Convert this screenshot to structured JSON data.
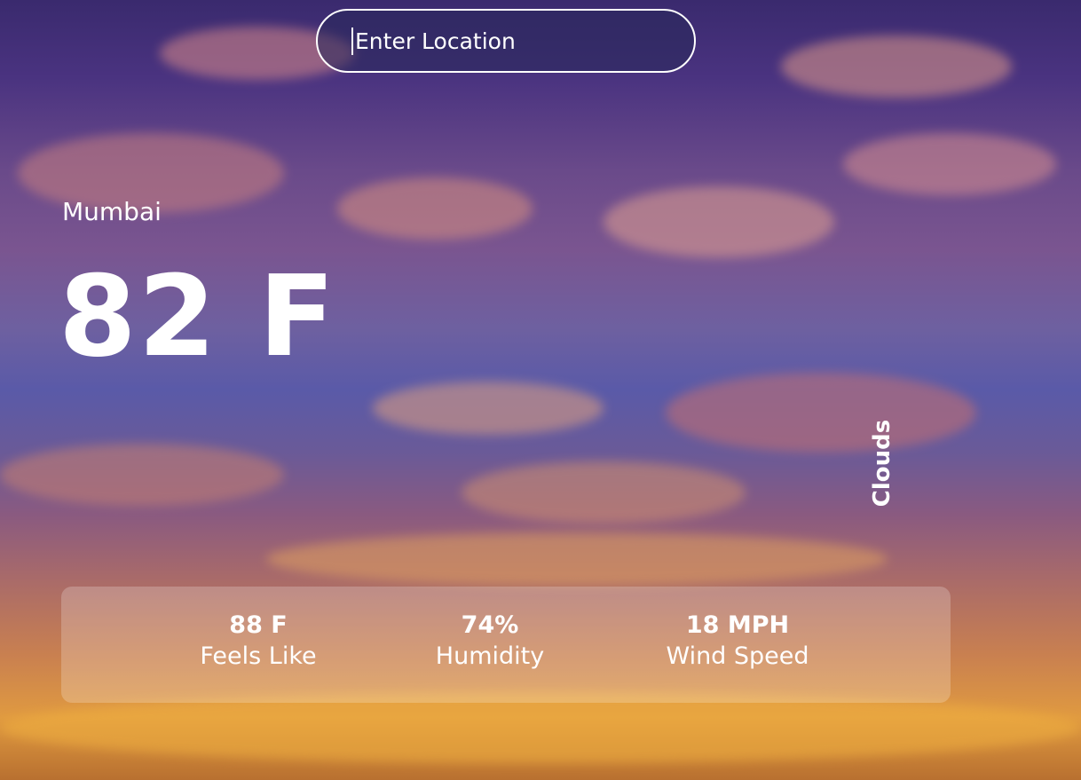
{
  "search": {
    "placeholder": "Enter Location",
    "value": ""
  },
  "current": {
    "city": "Mumbai",
    "temperature": "82 F",
    "condition": "Clouds"
  },
  "stats": {
    "feels_like": {
      "value": "88 F",
      "label": "Feels Like"
    },
    "humidity": {
      "value": "74%",
      "label": "Humidity"
    },
    "wind_speed": {
      "value": "18 MPH",
      "label": "Wind Speed"
    }
  },
  "colors": {
    "text": "#ffffff",
    "sky_top": "#3a2a6e",
    "sky_mid": "#5a5aa8",
    "sunset": "#e09a40"
  }
}
